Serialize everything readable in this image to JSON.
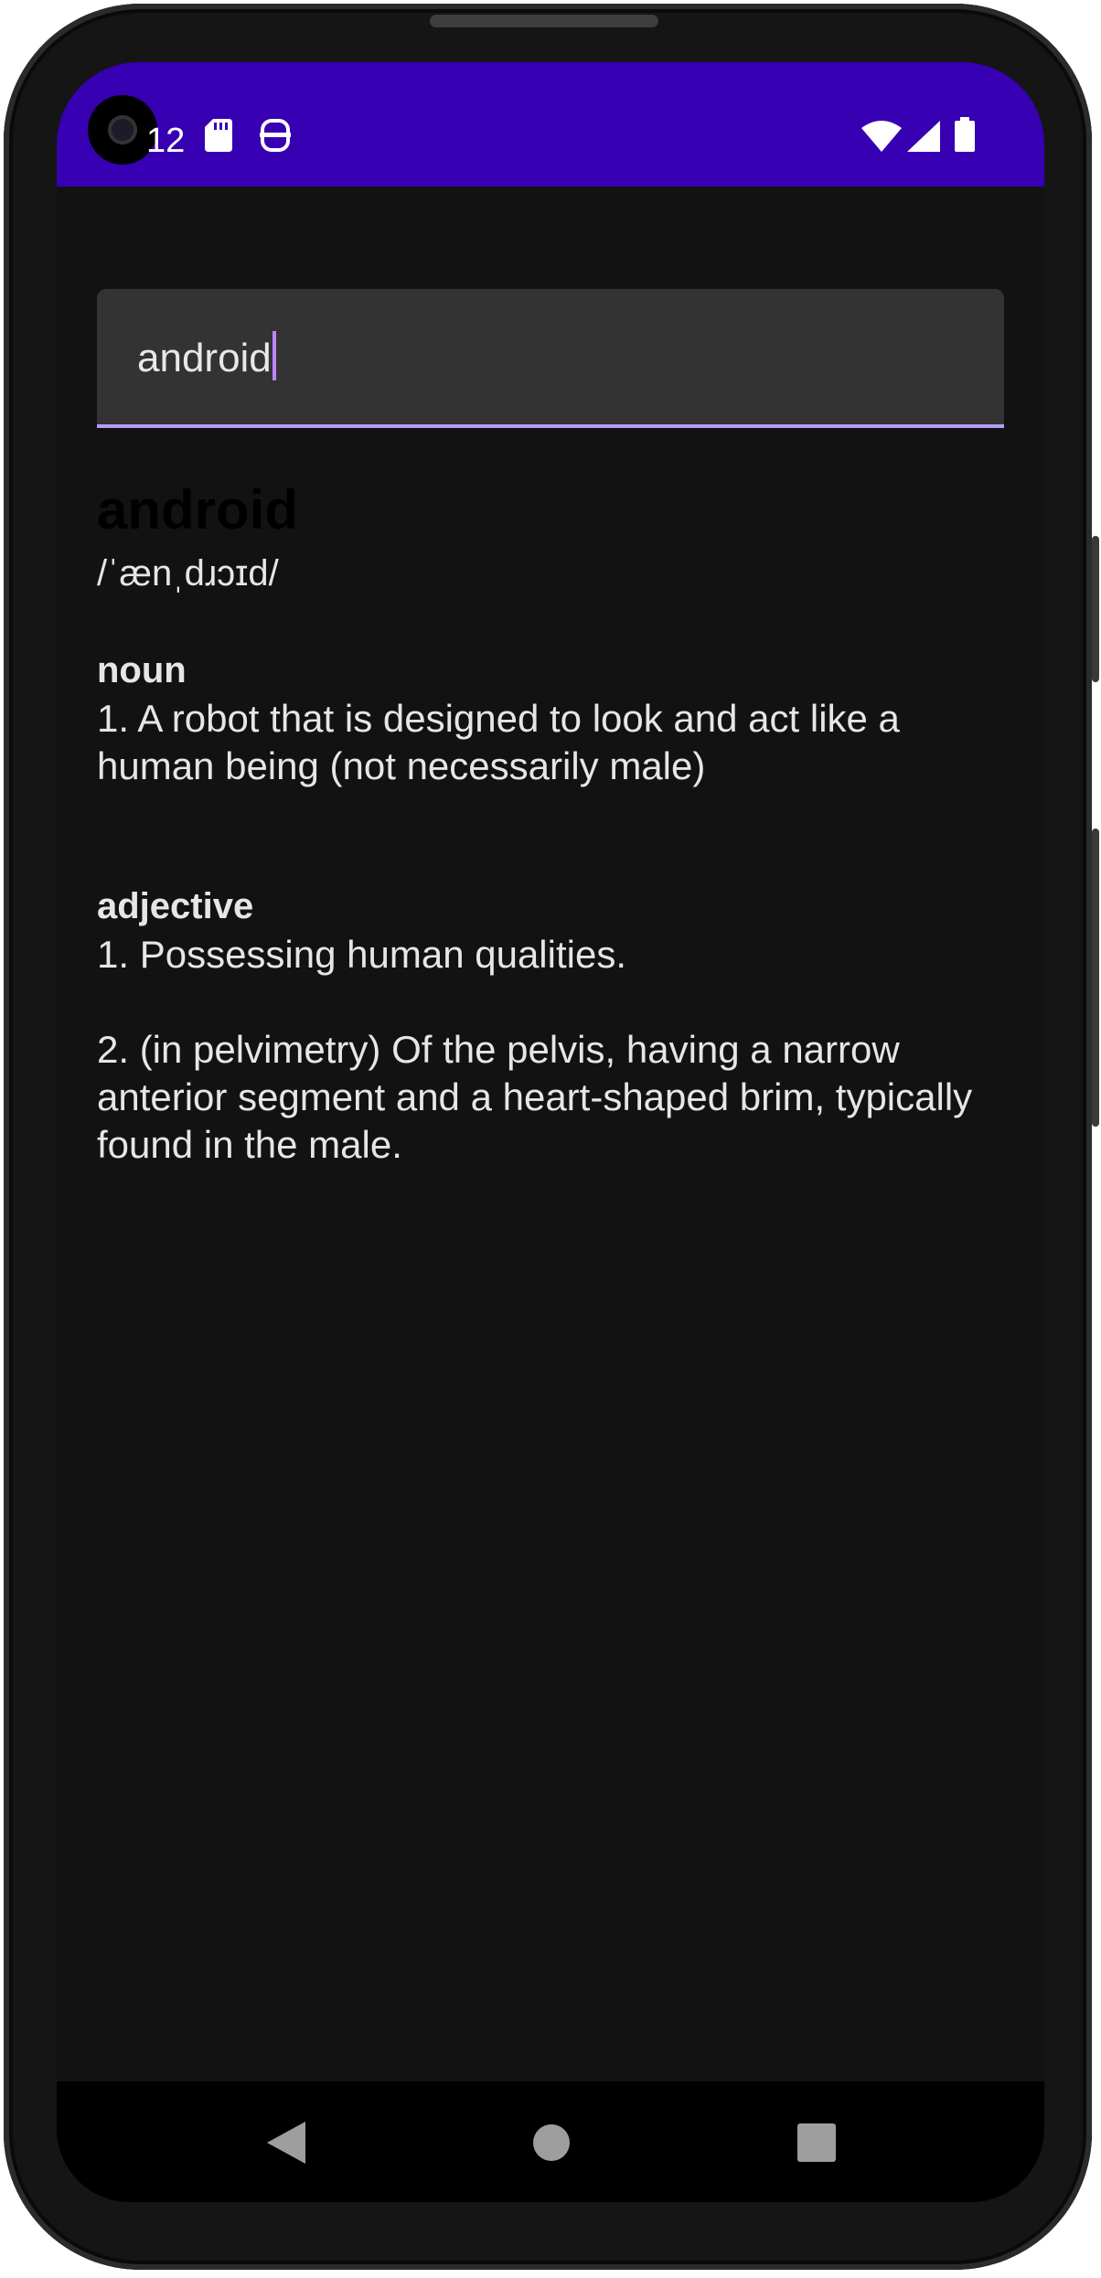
{
  "status_bar": {
    "time": "12",
    "icons": [
      "sd-card-icon",
      "accessibility-icon",
      "wifi-icon",
      "signal-icon",
      "battery-icon"
    ]
  },
  "search": {
    "value": "android",
    "underline_color": "#b69df8"
  },
  "entry": {
    "word": "android",
    "phonetic": "/ˈænˌdɹɔɪd/",
    "meanings": [
      {
        "part_of_speech": "noun",
        "definitions": [
          "1. A robot that is designed to look and act like a human being (not necessarily male)"
        ]
      },
      {
        "part_of_speech": "adjective",
        "definitions": [
          "1. Possessing human qualities.",
          "2. (in pelvimetry) Of the pelvis, having a narrow anterior segment and a heart-shaped brim, typically found in the male."
        ]
      }
    ]
  },
  "nav_bar": {
    "buttons": [
      "back-icon",
      "home-icon",
      "recents-icon"
    ]
  },
  "colors": {
    "status_bar": "#3700b3",
    "background": "#121212",
    "accent": "#bb86fc"
  }
}
